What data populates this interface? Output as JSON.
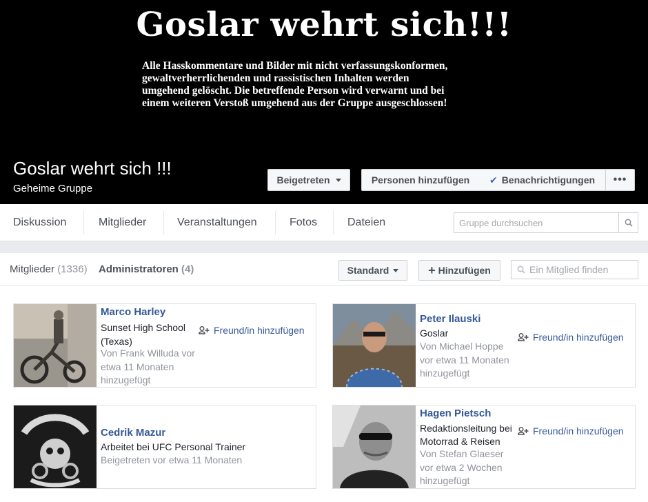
{
  "cover": {
    "title": "Goslar wehrt sich!!!",
    "notice_lines": [
      "Alle Hasskommentare und Bilder mit nicht verfassungskonformen,",
      "gewaltverherrlichenden und rassistischen Inhalten werden",
      "umgehend gelöscht. Die betreffende Person wird verwarnt und bei",
      "einem weiteren Verstoß umgehend aus der Gruppe ausgeschlossen!"
    ]
  },
  "group": {
    "name": "Goslar wehrt sich !!!",
    "type": "Geheime Gruppe",
    "joined_label": "Beigetreten",
    "add_people_label": "Personen hinzufügen",
    "notifications_label": "Benachrichtigungen",
    "more_label": "•••"
  },
  "nav": {
    "items": [
      "Diskussion",
      "Mitglieder",
      "Veranstaltungen",
      "Fotos",
      "Dateien"
    ],
    "search_placeholder": "Gruppe durchsuchen"
  },
  "members_header": {
    "members_label": "Mitglieder",
    "members_count": "1336",
    "admins_label": "Administratoren",
    "admins_count": "4",
    "sort_label": "Standard",
    "add_label": "Hinzufügen",
    "find_placeholder": "Ein Mitglied finden"
  },
  "admins": [
    {
      "name": "Marco Harley",
      "lines": [
        "Sunset High School",
        "(Texas)"
      ],
      "meta": [
        "Von Frank Willuda vor",
        "etwa 11 Monaten",
        "hinzugefügt"
      ],
      "action": "Freund/in hinzufügen"
    },
    {
      "name": "Peter Ilauski",
      "lines": [
        "Goslar"
      ],
      "meta": [
        "Von Michael Hoppe",
        "vor etwa 11 Monaten",
        "hinzugefügt"
      ],
      "action": "Freund/in hinzufügen"
    },
    {
      "name": "Cedrik Mazur",
      "lines": [
        "Arbeitet bei UFC Personal Trainer"
      ],
      "meta": [
        "Beigetreten vor etwa 11 Monaten"
      ],
      "action": ""
    },
    {
      "name": "Hagen Pietsch",
      "lines": [
        "Redaktionsleitung bei",
        "Motorrad & Reisen"
      ],
      "meta": [
        "Von Stefan Glaeser",
        "vor etwa 2 Wochen",
        "hinzugefügt"
      ],
      "action": "Freund/in hinzufügen"
    }
  ],
  "colors": {
    "link": "#365899",
    "accent": "#4267b2",
    "muted": "#90949c"
  }
}
